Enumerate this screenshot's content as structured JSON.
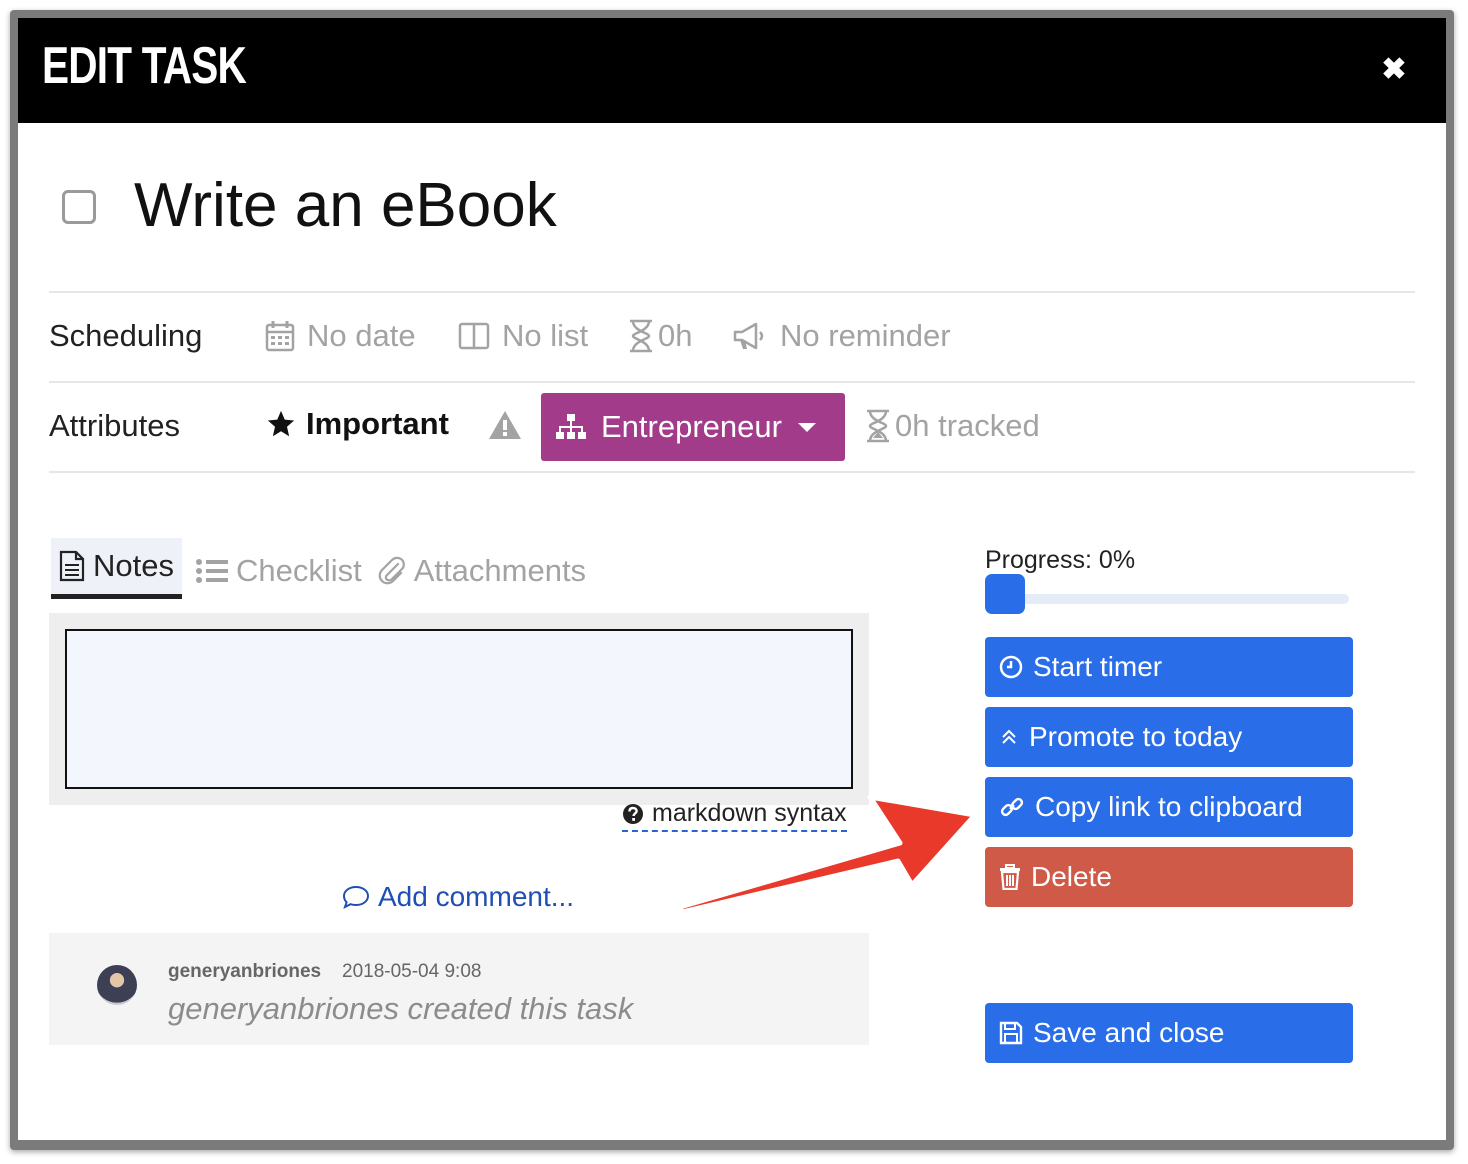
{
  "dialog": {
    "title": "EDIT TASK",
    "close_icon": "close-icon"
  },
  "task": {
    "title": "Write an eBook",
    "completed": false
  },
  "scheduling": {
    "label": "Scheduling",
    "date": "No date",
    "list": "No list",
    "estimate": "0h",
    "reminder": "No reminder"
  },
  "attributes": {
    "label": "Attributes",
    "important": "Important",
    "project": "Entrepreneur",
    "project_color": "#a23b8a",
    "tracked": "0h tracked"
  },
  "tabs": [
    {
      "label": "Notes",
      "icon": "document-icon",
      "active": true
    },
    {
      "label": "Checklist",
      "icon": "list-icon",
      "active": false
    },
    {
      "label": "Attachments",
      "icon": "paperclip-icon",
      "active": false
    }
  ],
  "notes": {
    "value": "",
    "markdown_link": "markdown syntax"
  },
  "comments": {
    "add_label": "Add comment...",
    "items": [
      {
        "user": "generyanbriones",
        "time": "2018-05-04 9:08",
        "text": "generyanbriones created this task"
      }
    ]
  },
  "progress": {
    "label": "Progress: 0%",
    "value": 0
  },
  "actions": {
    "start_timer": "Start timer",
    "promote": "Promote to today",
    "copy_link": "Copy link to clipboard",
    "delete": "Delete",
    "save_close": "Save and close"
  },
  "colors": {
    "primary": "#2a6de8",
    "danger": "#cf5a48",
    "project": "#a23b8a",
    "arrow": "#e8392a"
  }
}
